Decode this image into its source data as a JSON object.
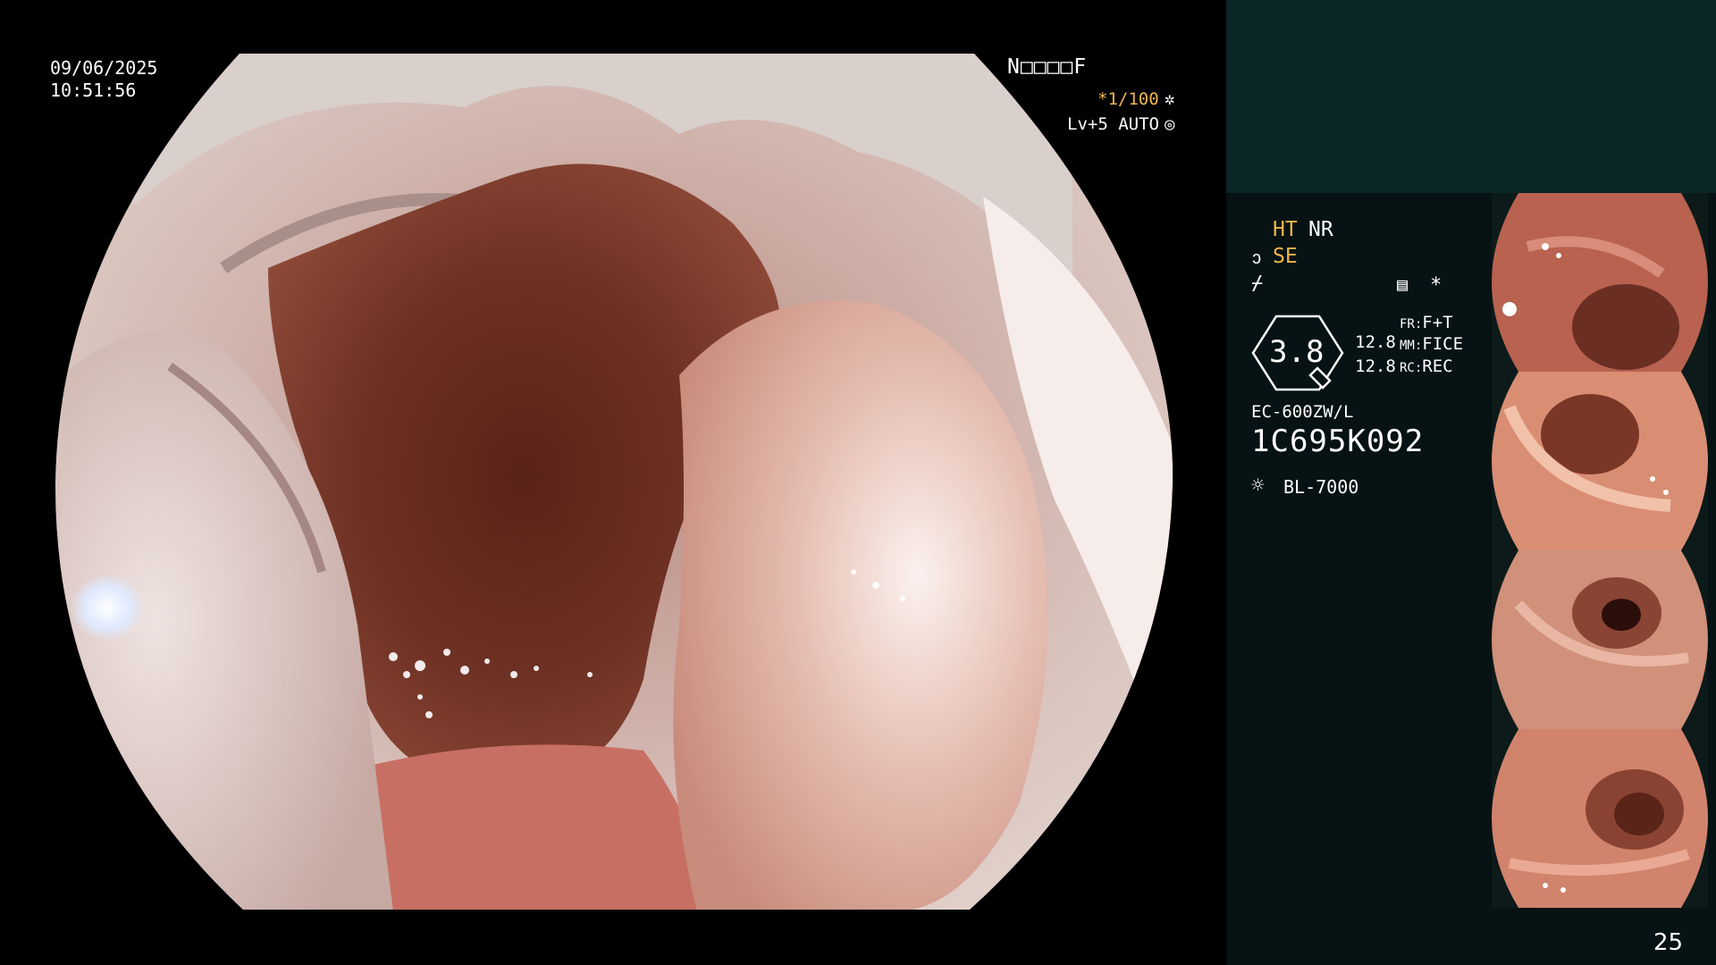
{
  "osd": {
    "date": "09/06/2025",
    "time": "10:51:56",
    "patient_id": "N□□□□F",
    "shutter": "*1/100",
    "shutter_icon": "✲",
    "level": "Lv+5 AUTO",
    "auto_icon": "◎"
  },
  "panel": {
    "ht": "HT",
    "nr": "NR",
    "se_icon": "ↄ",
    "se": "SE",
    "freeze_icon": "⌿",
    "settings_icon": "▤",
    "asterisk": "*",
    "enhancement": "3.8",
    "value_top": "12.8",
    "value_bottom": "12.8",
    "fr_key": "FR:",
    "fr_value": "F+T",
    "mm_key": "MM:",
    "mm_value": "FICE",
    "rc_key": "RC:",
    "rc_value": "REC",
    "model": "EC-600ZW/L",
    "serial": "1C695K092",
    "light_icon": "☼",
    "light_source": "BL-7000",
    "page": "25"
  },
  "colors": {
    "osd_text": "#ffffff",
    "accent_orange": "#f0b64a",
    "panel_bg": "#061213",
    "panel_top_bg": "#0b2626"
  }
}
